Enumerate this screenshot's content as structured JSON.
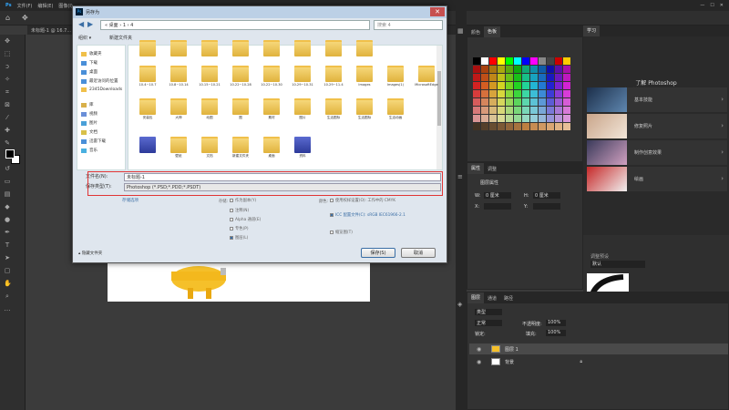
{
  "menubar": {
    "items": [
      "文件(F)",
      "编辑(E)",
      "图像(I)"
    ]
  },
  "doc_tab": {
    "label": "未标题-1 @ 16.7..."
  },
  "dialog": {
    "title": "另存为",
    "address": "« 桌面 › 1 › 4",
    "search_placeholder": "搜索 4",
    "organize": "组织 ▾",
    "new_folder": "新建文件夹",
    "nav_items": [
      "收藏夹",
      "下载",
      "桌面",
      "最近访问的位置",
      "2345Downloads",
      "库",
      "视频",
      "图片",
      "文档",
      "迅雷下载",
      "音乐"
    ],
    "files": [
      {
        "name": "",
        "kind": "folder"
      },
      {
        "name": "",
        "kind": "folder"
      },
      {
        "name": "",
        "kind": "folder"
      },
      {
        "name": "",
        "kind": "folder"
      },
      {
        "name": "",
        "kind": "folder"
      },
      {
        "name": "",
        "kind": "folder"
      },
      {
        "name": "",
        "kind": "folder"
      },
      {
        "name": "",
        "kind": "folder"
      },
      {
        "name": "10.4~10.7",
        "kind": "folder"
      },
      {
        "name": "10.8~10.14",
        "kind": "folder"
      },
      {
        "name": "10.15~10.21",
        "kind": "folder"
      },
      {
        "name": "10.22~10.28",
        "kind": "folder"
      },
      {
        "name": "10.22~10.30",
        "kind": "folder"
      },
      {
        "name": "10.29~10.31",
        "kind": "folder"
      },
      {
        "name": "10.29~11.4",
        "kind": "folder"
      },
      {
        "name": "Images",
        "kind": "folder"
      },
      {
        "name": "Images(1)",
        "kind": "folder"
      },
      {
        "name": "MicrosoftEdge",
        "kind": "folder"
      },
      {
        "name": "安装包",
        "kind": "folder"
      },
      {
        "name": "大神",
        "kind": "folder"
      },
      {
        "name": "动图",
        "kind": "folder"
      },
      {
        "name": "图",
        "kind": "folder"
      },
      {
        "name": "素材",
        "kind": "folder"
      },
      {
        "name": "图片",
        "kind": "folder"
      },
      {
        "name": "生活图标",
        "kind": "folder"
      },
      {
        "name": "生活图标",
        "kind": "folder"
      },
      {
        "name": "生活动画",
        "kind": "folder"
      },
      {
        "name": "",
        "kind": "pdoc"
      },
      {
        "name": "壁纸",
        "kind": "folder"
      },
      {
        "name": "文档",
        "kind": "folder"
      },
      {
        "name": "新建文件夹",
        "kind": "folder"
      },
      {
        "name": "桌面",
        "kind": "folder"
      },
      {
        "name": "资料",
        "kind": "pdoc"
      }
    ],
    "filename_label": "文件名(N):",
    "filename_value": "未标题-1",
    "filetype_label": "保存类型(T):",
    "filetype_value": "Photoshop (*.PSD;*.PDD;*.PSDT)",
    "save_options_label": "存储选项",
    "options_col1": [
      "作为副本(Y)",
      "注释(N)",
      "Alpha 通道(E)",
      "专色(P)",
      "图层(L)"
    ],
    "options_col2": [
      "使用校样设置(O): 工作中的 CMYK",
      "ICC 配置文件(C): sRGB IEC61966-2.1",
      "缩览图(T)"
    ],
    "options_label1": "存储:",
    "options_label2": "颜色:",
    "hide_folders": "隐藏文件夹",
    "save_button": "保存(S)",
    "cancel_button": "取消"
  },
  "swatches_panel": {
    "tabs": [
      "颜色",
      "色板"
    ]
  },
  "learn_panel": {
    "tab": "学习",
    "title": "了解 Photoshop",
    "subtitle": "在此用教程内容直接获得分步教程。从下面选择一个主题开始教程。",
    "cards": [
      "基本技能",
      "修复照片",
      "制作创意效果",
      "绘画"
    ]
  },
  "properties_panel": {
    "tabs": [
      "属性",
      "调整"
    ],
    "title": "图层属性",
    "w_label": "W:",
    "h_label": "H:",
    "x_label": "X:",
    "y_label": "Y:",
    "w_value": "0 厘米",
    "h_value": "0 厘米"
  },
  "adjust_panel": {
    "label": "调整预设",
    "value": "默认"
  },
  "layers_panel": {
    "tabs": [
      "图层",
      "通道",
      "路径"
    ],
    "kind_label": "类型",
    "mode": "正常",
    "opacity_label": "不透明度:",
    "opacity": "100%",
    "lock_label": "锁定:",
    "fill_label": "填充:",
    "fill": "100%",
    "layers": [
      "图层 1",
      "背景"
    ]
  },
  "colors": {
    "red_highlight": "#e03535",
    "ps_dark": "#323232"
  }
}
